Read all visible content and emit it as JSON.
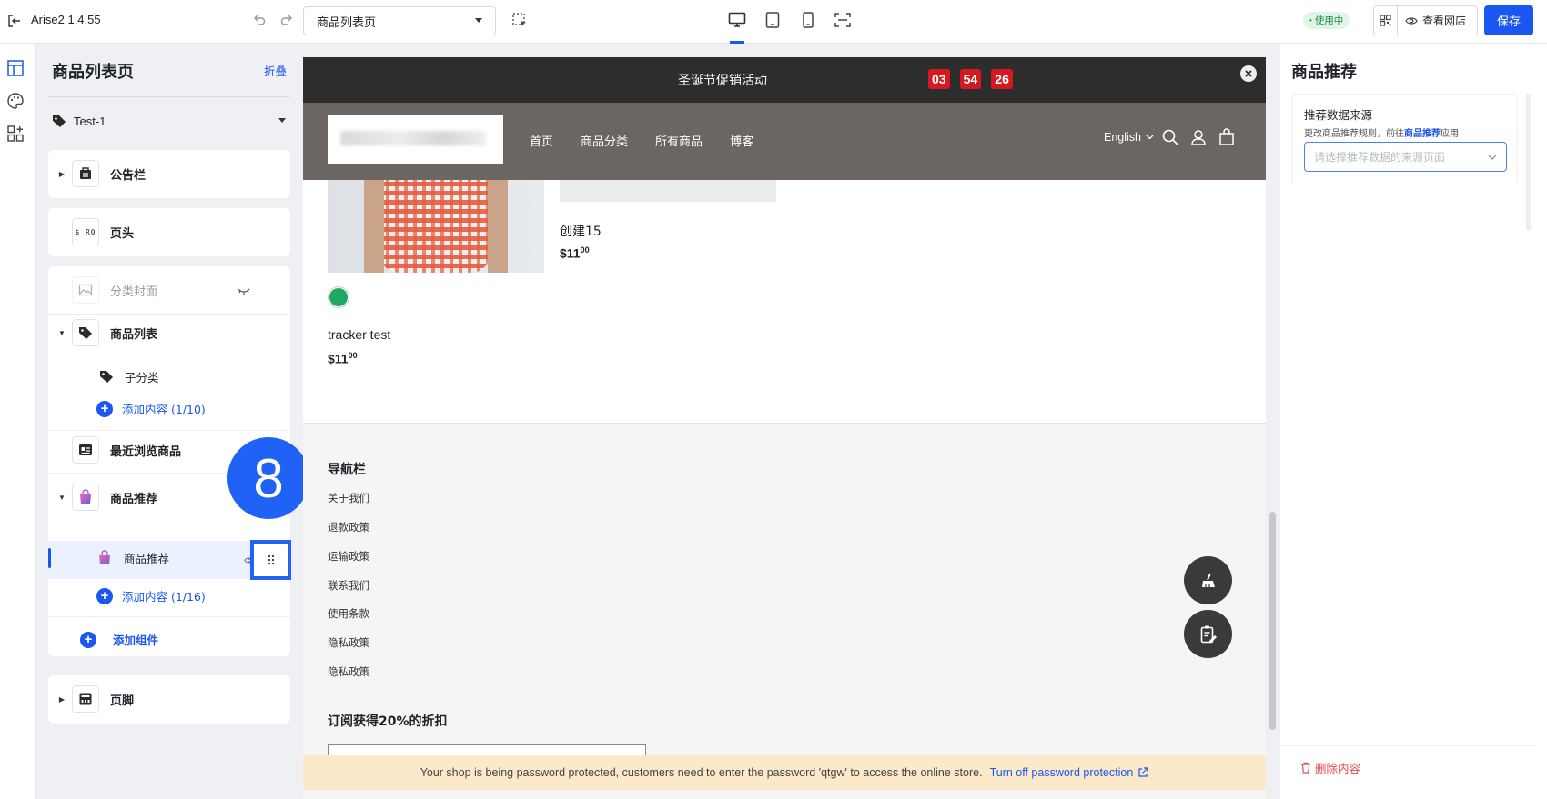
{
  "app": {
    "title": "Arise2 1.4.55"
  },
  "toolbar": {
    "page_select": "商品列表页",
    "status_badge": "使用中",
    "view_store": "查看网店",
    "save": "保存"
  },
  "left_panel": {
    "title": "商品列表页",
    "collapse": "折叠",
    "template_select": "Test-1",
    "sections": {
      "announcement": "公告栏",
      "header": "页头",
      "header_logo_text": "$ R0",
      "category_cover": "分类封面",
      "product_list": "商品列表",
      "subcategory": "子分类",
      "add_content_list": "添加内容 (1/10)",
      "recent_viewed": "最近浏览商品",
      "recommend": "商品推荐",
      "recommend_child": "商品推荐",
      "add_content_recommend": "添加内容 (1/16)",
      "add_component": "添加组件",
      "footer": "页脚"
    },
    "step_badge": "8"
  },
  "preview": {
    "promo_text": "圣诞节促销活动",
    "countdown": [
      "03",
      "54",
      "26"
    ],
    "nav": [
      "首页",
      "商品分类",
      "所有商品",
      "博客"
    ],
    "language": "English",
    "products": [
      {
        "name": "创建15",
        "price": "$11",
        "cents": "00"
      },
      {
        "name": "tracker test",
        "price": "$11",
        "cents": "00"
      }
    ],
    "footer_nav_title": "导航栏",
    "footer_links": [
      "关于我们",
      "退款政策",
      "运输政策",
      "联系我们",
      "使用条款",
      "隐私政策",
      "隐私政策"
    ],
    "subscribe_title": "订阅获得20%的折扣",
    "password_notice": "Your shop is being password protected, customers need to enter the password 'qtgw' to access the online store.",
    "turn_off_link": "Turn off password protection"
  },
  "right_panel": {
    "title": "商品推荐",
    "source_label": "推荐数据来源",
    "source_hint_pre": "更改商品推荐规则，前往",
    "source_hint_link": "商品推荐",
    "source_hint_post": "应用",
    "source_placeholder": "请选择推荐数据的来源页面",
    "delete": "删除内容"
  },
  "colors": {
    "accent": "#1a56f0",
    "countdown": "#d7191f",
    "header_bg": "#6b6661",
    "promo_bg": "#2d2d2d",
    "notice_bg": "#fbe9c9",
    "delete": "#e5484d"
  }
}
